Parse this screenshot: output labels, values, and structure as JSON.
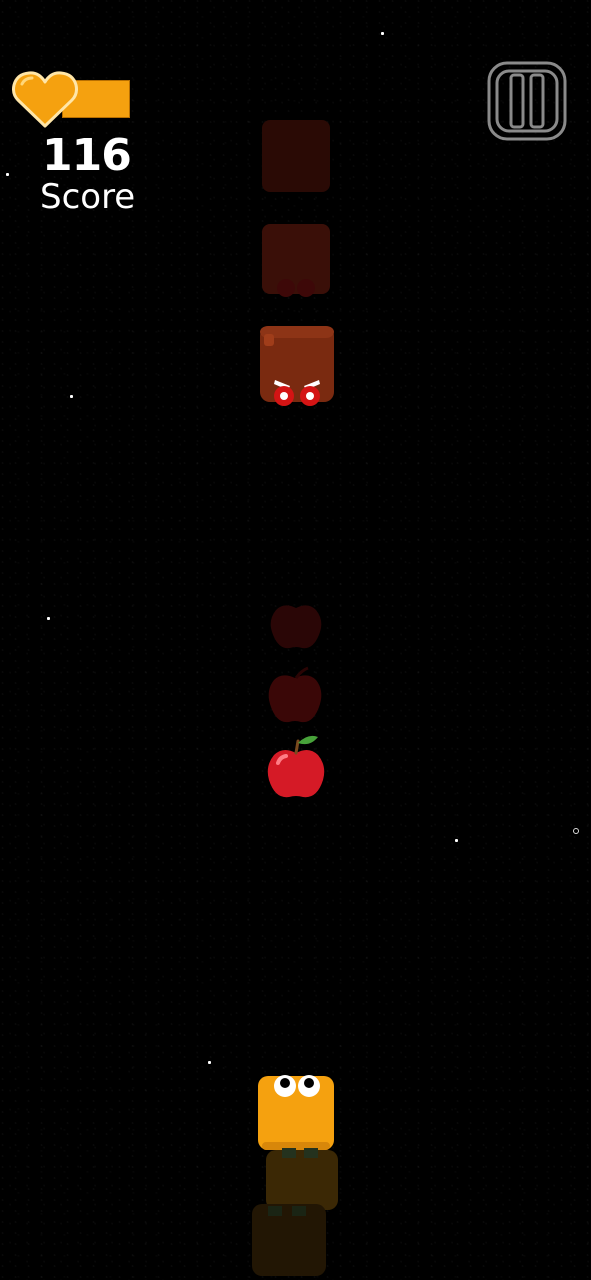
{
  "hud": {
    "health_fraction": 1.0,
    "score_value": "116",
    "score_label": "Score"
  },
  "icons": {
    "health": "heart-icon",
    "pause": "pause-icon"
  },
  "colors": {
    "background": "#000000",
    "health": "#f5a10f",
    "enemy": "#7a2a10",
    "player": "#f5a10f",
    "apple": "#d51a26"
  },
  "entities": {
    "enemy": "enemy-block",
    "apple": "apple",
    "player": "player-block"
  }
}
